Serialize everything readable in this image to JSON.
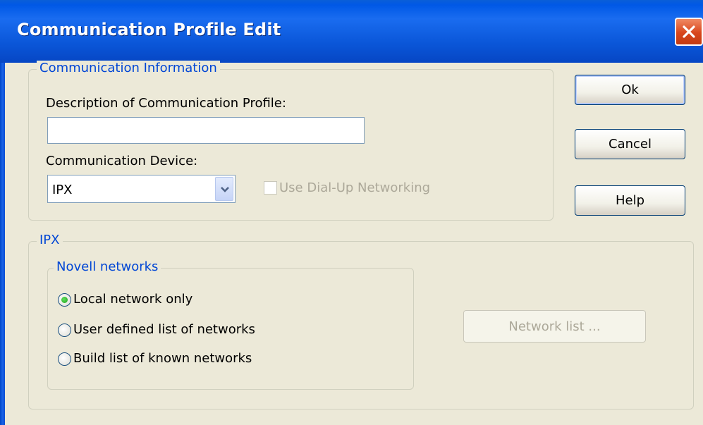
{
  "window": {
    "title": "Communication Profile Edit"
  },
  "communication_info": {
    "legend": "Communication Information",
    "description_label": "Description of Communication Profile:",
    "description_value": "",
    "device_label": "Communication Device:",
    "device_value": "IPX",
    "dialup_label": "Use Dial-Up Networking",
    "dialup_checked": false,
    "dialup_enabled": false
  },
  "buttons": {
    "ok": "Ok",
    "cancel": "Cancel",
    "help": "Help"
  },
  "ipx": {
    "legend": "IPX",
    "novell": {
      "legend": "Novell networks",
      "options": [
        {
          "label": "Local network only",
          "selected": true
        },
        {
          "label": "User defined list of networks",
          "selected": false
        },
        {
          "label": "Build list of known networks",
          "selected": false
        }
      ]
    },
    "network_list_button": "Network list ...",
    "network_list_enabled": false
  },
  "colors": {
    "titlebar": "#0058e6",
    "dialog_bg": "#ece9d8",
    "group_legend": "#0046d5",
    "disabled_text": "#aca899",
    "close_button": "#d8461c"
  },
  "icons": {
    "close": "close-icon",
    "dropdown": "chevron-down-icon"
  }
}
